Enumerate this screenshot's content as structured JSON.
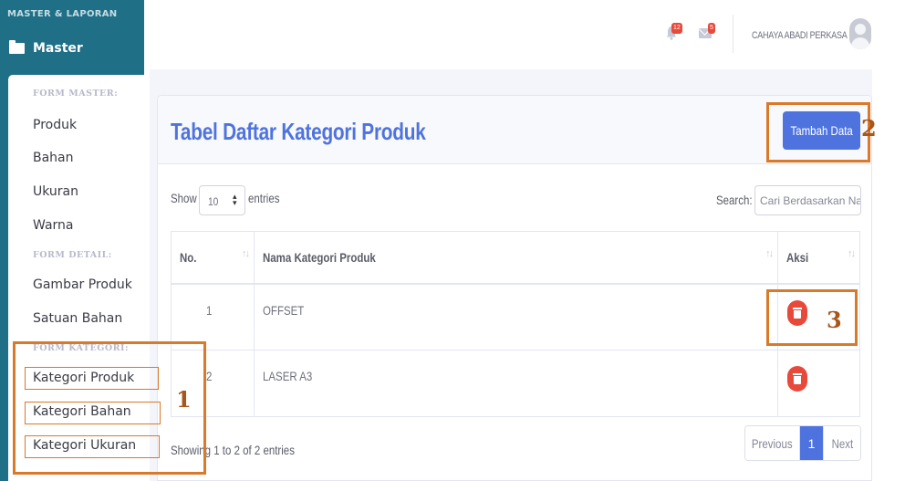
{
  "sidebar": {
    "heading": "MASTER & LAPORAN",
    "master_label": "Master",
    "form_master_header": "FORM MASTER:",
    "form_master_items": [
      "Produk",
      "Bahan",
      "Ukuran",
      "Warna"
    ],
    "form_detail_header": "FORM DETAIL:",
    "form_detail_items": [
      "Gambar Produk",
      "Satuan Bahan"
    ],
    "form_kategori_header": "FORM KATEGORI:",
    "form_kategori_items": [
      "Kategori Produk",
      "Kategori Bahan",
      "Kategori Ukuran"
    ]
  },
  "topbar": {
    "alerts_count": "12",
    "messages_count": "5",
    "user_name": "CAHAYA ABADI PERKASA"
  },
  "card": {
    "title": "Tabel Daftar Kategori Produk",
    "add_button": "Tambah Data",
    "show_label": "Show",
    "entries_value": "10",
    "entries_label": "entries",
    "search_label": "Search:",
    "search_placeholder": "Cari Berdasarkan Nama",
    "columns": [
      "No.",
      "Nama Kategori Produk",
      "Aksi"
    ],
    "rows": [
      {
        "no": "1",
        "name": "OFFSET"
      },
      {
        "no": "2",
        "name": "LASER A3"
      }
    ],
    "info": "Showing 1 to 2 of 2 entries",
    "pagination": {
      "previous": "Previous",
      "current": "1",
      "next": "Next"
    }
  },
  "annotations": {
    "label_1": "1",
    "label_2": "2",
    "label_3": "3",
    "color": "#d9792a"
  }
}
